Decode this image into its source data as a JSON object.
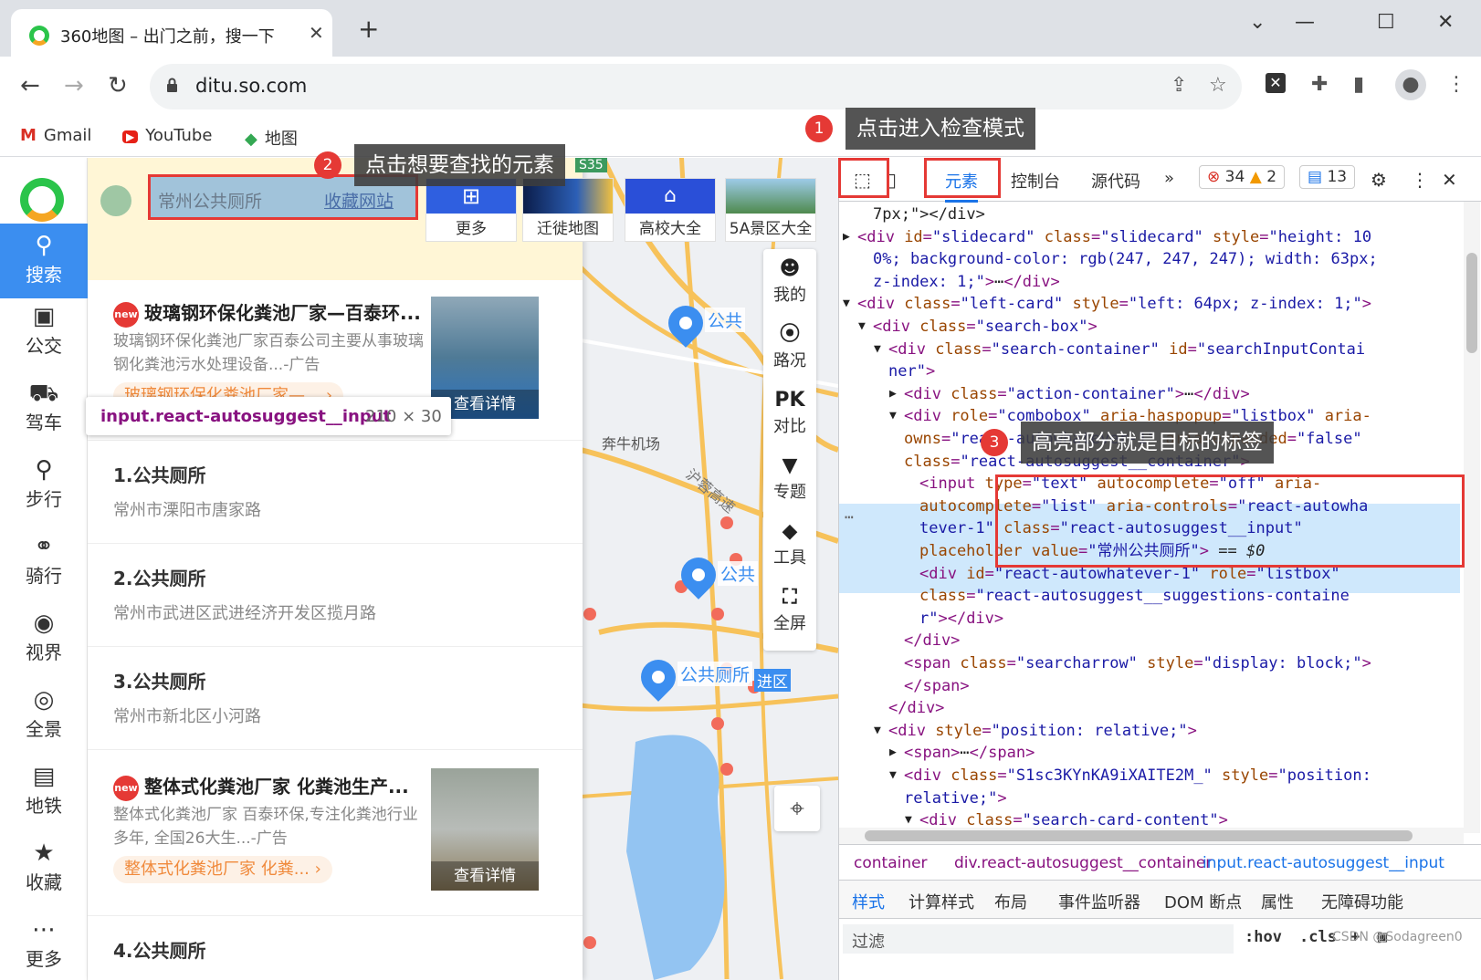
{
  "browser": {
    "tab_title": "360地图 – 出门之前，搜一下",
    "tab_close": "✕",
    "new_tab": "+",
    "url": "ditu.so.com",
    "bookmarks": [
      {
        "label": "Gmail",
        "icon": "gmail-icon"
      },
      {
        "label": "YouTube",
        "icon": "youtube-icon"
      },
      {
        "label": "地图",
        "icon": "maps-icon"
      }
    ]
  },
  "left_nav": {
    "items": [
      {
        "label": "搜索",
        "icon": "search-icon",
        "glyph": "⚲"
      },
      {
        "label": "公交",
        "icon": "bus-icon",
        "glyph": "🚌"
      },
      {
        "label": "驾车",
        "icon": "car-icon",
        "glyph": "🚗"
      },
      {
        "label": "步行",
        "icon": "walk-icon",
        "glyph": "🚶"
      },
      {
        "label": "骑行",
        "icon": "bike-icon",
        "glyph": "🚲"
      },
      {
        "label": "视界",
        "icon": "eye-icon",
        "glyph": "👁"
      },
      {
        "label": "全景",
        "icon": "panorama-icon",
        "glyph": "◉"
      },
      {
        "label": "地铁",
        "icon": "subway-icon",
        "glyph": "🚇"
      },
      {
        "label": "收藏",
        "icon": "star-icon",
        "glyph": "★"
      },
      {
        "label": "更多",
        "icon": "more-icon",
        "glyph": "⋯"
      }
    ]
  },
  "search": {
    "value": "常州公共厕所",
    "favorite_link": "收藏网站"
  },
  "inspect_tooltip": {
    "selector": "input.react-autosuggest__input",
    "size": "210 × 30"
  },
  "quick_tiles": [
    {
      "label": "更多"
    },
    {
      "label": "迁徙地图"
    },
    {
      "label": "高校大全"
    },
    {
      "label": "5A景区大全"
    }
  ],
  "tile_badge": "S35",
  "results": {
    "ads": [
      {
        "badge": "new",
        "title": "玻璃钢环保化粪池厂家—百泰环...",
        "desc": "玻璃钢环保化粪池厂家百泰公司主要从事玻璃钢化粪池污水处理设备...-广告",
        "link": "玻璃钢环保化粪池厂家—...  ›",
        "button": "查看详情"
      },
      {
        "badge": "new",
        "title": "整体式化粪池厂家 化粪池生产...",
        "desc": "整体式化粪池厂家 百泰环保,专注化粪池行业多年, 全国26大生...-广告",
        "link": "整体式化粪池厂家 化粪...  ›",
        "button": "查看详情"
      }
    ],
    "items": [
      {
        "title": "1.公共厕所",
        "addr": "常州市溧阳市唐家路"
      },
      {
        "title": "2.公共厕所",
        "addr": "常州市武进区武进经济开发区揽月路"
      },
      {
        "title": "3.公共厕所",
        "addr": "常州市新北区小河路"
      },
      {
        "title": "4.公共厕所",
        "addr": ""
      }
    ]
  },
  "map": {
    "tools": [
      {
        "label": "我的",
        "icon": "user-icon",
        "glyph": "☻"
      },
      {
        "label": "路况",
        "icon": "traffic-icon",
        "glyph": "⦿"
      },
      {
        "label": "对比",
        "icon": "compare-icon",
        "glyph": "PK"
      },
      {
        "label": "专题",
        "icon": "bookmark-icon",
        "glyph": "▼"
      },
      {
        "label": "工具",
        "icon": "layers-icon",
        "glyph": "◆"
      },
      {
        "label": "全屏",
        "icon": "fullscreen-icon",
        "glyph": "⛶"
      }
    ],
    "pin_labels": [
      "公共",
      "公共",
      "公共厕所"
    ],
    "place_labels": [
      "奔牛机场",
      "沪蓉高速",
      "进区",
      "公",
      "共"
    ]
  },
  "devtools": {
    "tabs": [
      "元素",
      "控制台",
      "源代码"
    ],
    "more": "»",
    "errors": "34",
    "warnings": "2",
    "messages": "13",
    "dom_lines": [
      {
        "i": 1,
        "h": "<span class=\"tx\">7px;\"&gt;&lt;/div&gt;</span>"
      },
      {
        "i": 0,
        "a": "▶",
        "h": "&lt;div <span class=\"an\">id</span>=<span class=\"av\">\"slidecard\"</span> <span class=\"an\">class</span>=<span class=\"av\">\"slidecard\"</span> <span class=\"an\">style</span>=<span class=\"av\">\"height: 10</span>"
      },
      {
        "i": 1,
        "h": "<span class=\"av\">0%; background-color: rgb(247, 247, 247); width: 63px;</span>"
      },
      {
        "i": 1,
        "h": "<span class=\"av\">z-index: 1;\"</span>&gt;<span class=\"tx\">⋯</span>&lt;/div&gt;"
      },
      {
        "i": 0,
        "a": "▼",
        "h": "&lt;div <span class=\"an\">class</span>=<span class=\"av\">\"left-card\"</span> <span class=\"an\">style</span>=<span class=\"av\">\"left: 64px; z-index: 1;\"</span>&gt;"
      },
      {
        "i": 1,
        "a": "▼",
        "h": "&lt;div <span class=\"an\">class</span>=<span class=\"av\">\"search-box\"</span>&gt;"
      },
      {
        "i": 2,
        "a": "▼",
        "h": "&lt;div <span class=\"an\">class</span>=<span class=\"av\">\"search-container\"</span> <span class=\"an\">id</span>=<span class=\"av\">\"searchInputContai</span>"
      },
      {
        "i": 2,
        "h": "<span class=\"av\">ner\"</span>&gt;"
      },
      {
        "i": 3,
        "a": "▶",
        "h": "&lt;div <span class=\"an\">class</span>=<span class=\"av\">\"action-container\"</span>&gt;<span class=\"tx\">⋯</span>&lt;/div&gt;"
      },
      {
        "i": 3,
        "a": "▼",
        "h": "&lt;div <span class=\"an\">role</span>=<span class=\"av\">\"combobox\"</span> <span class=\"an\">aria-haspopup</span>=<span class=\"av\">\"listbox\"</span> <span class=\"an\">aria-</span>"
      },
      {
        "i": 3,
        "h": "<span class=\"an\">owns</span>=<span class=\"av\">\"react-autowhatever-1\"</span> <span class=\"an\">aria-expanded</span>=<span class=\"av\">\"false\"</span>"
      },
      {
        "i": 3,
        "h": "<span class=\"an\">class</span>=<span class=\"av\">\"react-autosuggest__container\"</span>&gt;"
      },
      {
        "i": 4,
        "h": "&lt;input <span class=\"an\">type</span>=<span class=\"av\">\"text\"</span> <span class=\"an\">autocomplete</span>=<span class=\"av\">\"off\"</span> <span class=\"an\">aria-</span>"
      },
      {
        "i": 4,
        "h": "<span class=\"an\">autocomplete</span>=<span class=\"av\">\"list\"</span> <span class=\"an\">aria-controls</span>=<span class=\"av\">\"react-autowha</span>"
      },
      {
        "i": 4,
        "h": "<span class=\"av\">tever-1\"</span> <span class=\"an\">class</span>=<span class=\"av\">\"react-autosuggest__input\"</span>"
      },
      {
        "i": 4,
        "h": "<span class=\"an\">placeholder value</span>=<span class=\"av\">\"常州公共厕所\"</span>&gt; <span class=\"tx\">== <i>$0</i></span>"
      },
      {
        "i": 4,
        "h": "&lt;div <span class=\"an\">id</span>=<span class=\"av\">\"react-autowhatever-1\"</span> <span class=\"an\">role</span>=<span class=\"av\">\"listbox\"</span>"
      },
      {
        "i": 4,
        "h": "<span class=\"an\">class</span>=<span class=\"av\">\"react-autosuggest__suggestions-containe</span>"
      },
      {
        "i": 4,
        "h": "<span class=\"av\">r\"</span>&gt;&lt;/div&gt;"
      },
      {
        "i": 3,
        "h": "&lt;/div&gt;"
      },
      {
        "i": 3,
        "h": "&lt;span <span class=\"an\">class</span>=<span class=\"av\">\"searcharrow\"</span> <span class=\"an\">style</span>=<span class=\"av\">\"display: block;\"</span>&gt;"
      },
      {
        "i": 3,
        "h": "&lt;/span&gt;"
      },
      {
        "i": 2,
        "h": "&lt;/div&gt;"
      },
      {
        "i": 2,
        "a": "▼",
        "h": "&lt;div <span class=\"an\">style</span>=<span class=\"av\">\"position: relative;\"</span>&gt;"
      },
      {
        "i": 3,
        "a": "▶",
        "h": "&lt;span&gt;<span class=\"tx\">⋯</span>&lt;/span&gt;"
      },
      {
        "i": 3,
        "a": "▼",
        "h": "&lt;div <span class=\"an\">class</span>=<span class=\"av\">\"S1sc3KYnKA9iXAITE2M_\"</span> <span class=\"an\">style</span>=<span class=\"av\">\"position:</span>"
      },
      {
        "i": 3,
        "h": "<span class=\"av\">relative;\"</span>&gt;"
      },
      {
        "i": 4,
        "a": "▼",
        "h": "&lt;div <span class=\"an\">class</span>=<span class=\"av\">\"search-card-content\"</span>&gt;"
      }
    ],
    "breadcrumbs": [
      "container",
      "div.react-autosuggest__container",
      "input.react-autosuggest__input"
    ],
    "subtabs": [
      "样式",
      "计算样式",
      "布局",
      "事件监听器",
      "DOM 断点",
      "属性",
      "无障碍功能"
    ],
    "filter_placeholder": "过滤",
    "hov": ":hov",
    "cls": ".cls",
    "ellipsis": "⋯"
  },
  "callouts": [
    {
      "num": "1",
      "text": "点击进入检查模式"
    },
    {
      "num": "2",
      "text": "点击想要查找的元素"
    },
    {
      "num": "3",
      "text": "高亮部分就是目标的标签"
    }
  ],
  "watermark": "CSDN @Sodagreen0"
}
